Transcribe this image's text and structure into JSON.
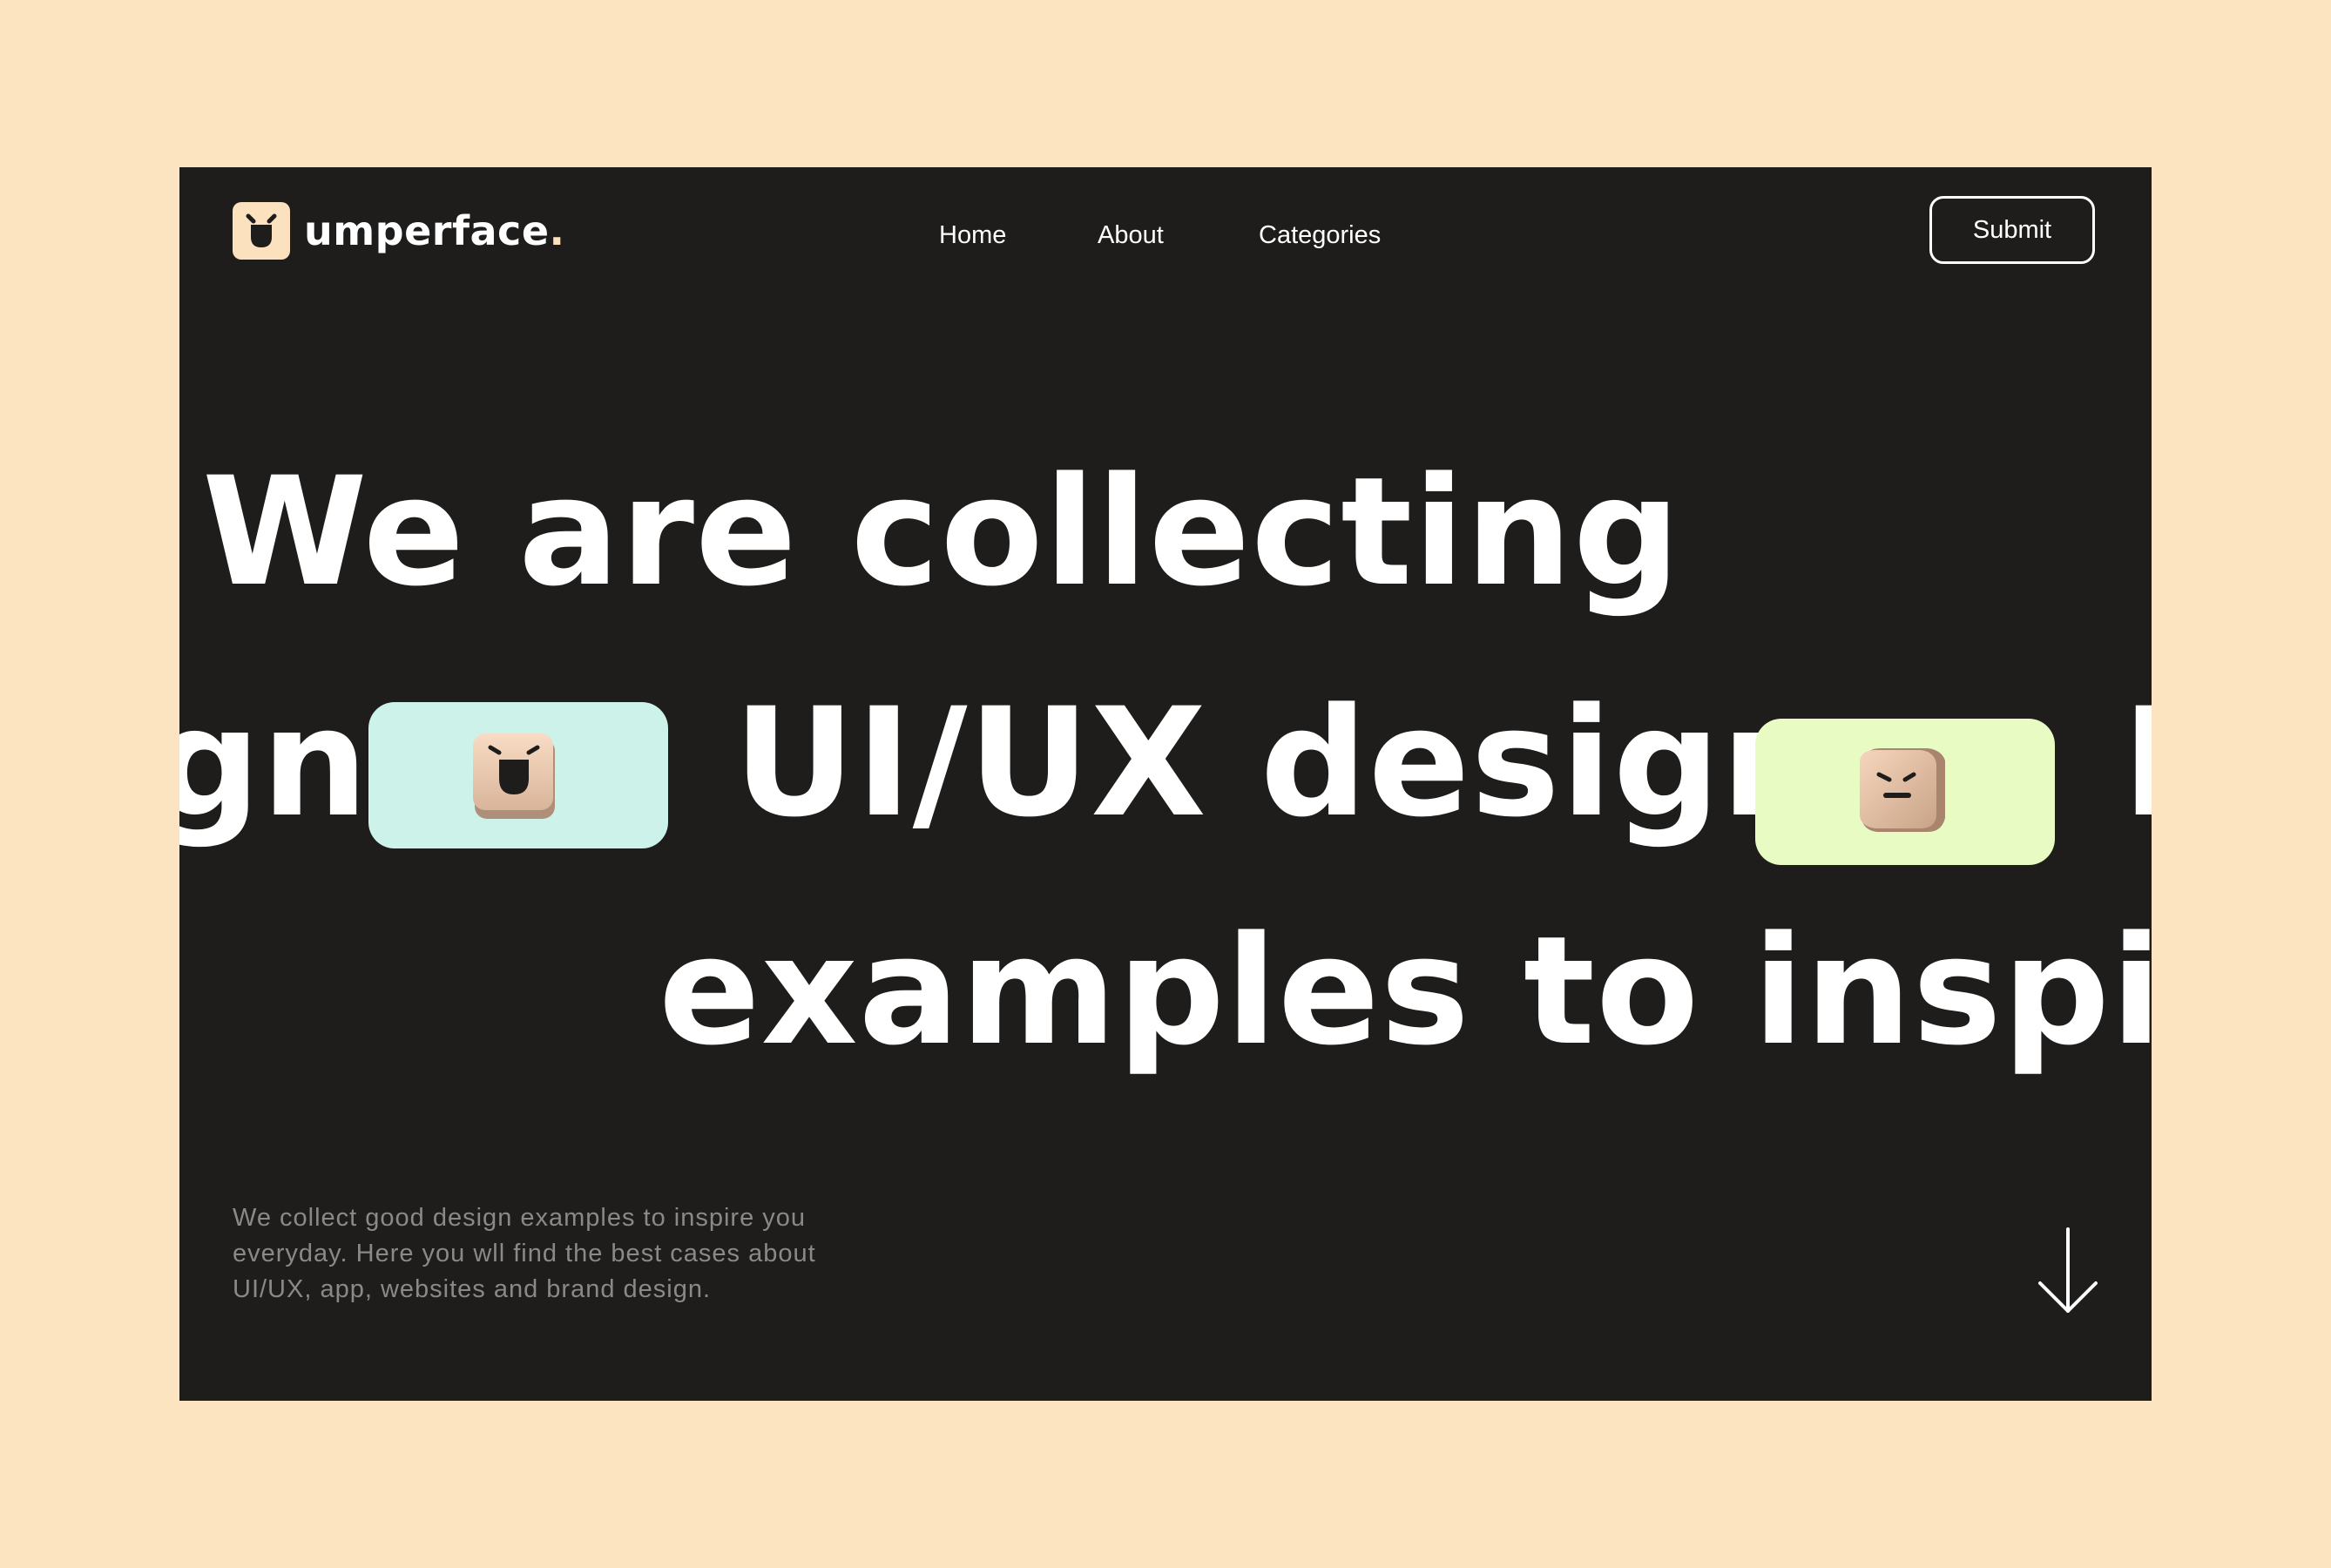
{
  "brand": {
    "name": "umperface",
    "dot": ".",
    "logo_icon": "smiling-cube-logo-icon",
    "accent_color": "#fbe1bd"
  },
  "nav": {
    "items": [
      {
        "label": "Home"
      },
      {
        "label": "About"
      },
      {
        "label": "Categories"
      }
    ],
    "submit_label": "Submit"
  },
  "hero": {
    "line1": "We are collecting",
    "line2_left_fragment": "gn",
    "line2_main": "UI/UX design",
    "line2_right_fragment": "I",
    "line3": "examples to inspire",
    "pills": [
      {
        "color": "#cdf2ea",
        "icon": "laughing-cube-icon"
      },
      {
        "color": "#e8fbc3",
        "icon": "neutral-cube-icon"
      }
    ]
  },
  "footer": {
    "description": "We collect good design examples to inspire you everyday. Here you wll find the best cases about UI/UX, app, websites and brand design.",
    "scroll_icon": "arrow-down-icon"
  },
  "colors": {
    "page_background": "#fde4c0",
    "frame_background": "#1e1d1c",
    "text": "#ffffff",
    "muted_text": "#8b8986"
  }
}
